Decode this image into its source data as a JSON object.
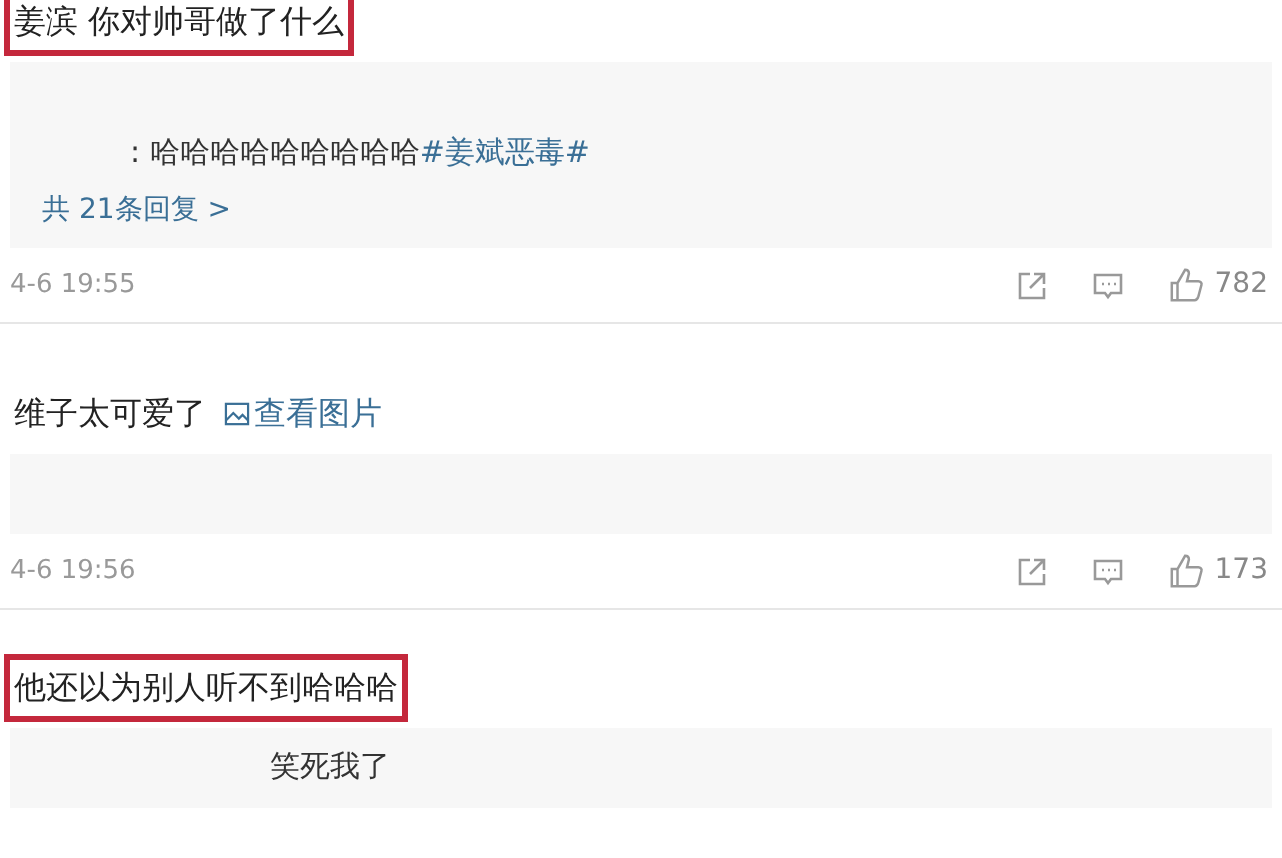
{
  "comments": [
    {
      "text": "姜滨 你对帅哥做了什么",
      "highlighted": true,
      "replies": [
        {
          "text": ": 哈哈哈哈哈哈哈哈哈",
          "hashtag": "#姜斌恶毒#"
        }
      ],
      "reply_count": "共 21条回复 >",
      "time": "4-6 19:55",
      "likes": "782"
    },
    {
      "text": "维子太可爱了",
      "link": "查看图片",
      "time": "4-6 19:56",
      "likes": "173",
      "highlighted": false
    },
    {
      "text": "他还以为别人听不到哈哈哈",
      "highlighted": true,
      "replies": [
        {
          "text": "笑死我了"
        }
      ]
    }
  ]
}
